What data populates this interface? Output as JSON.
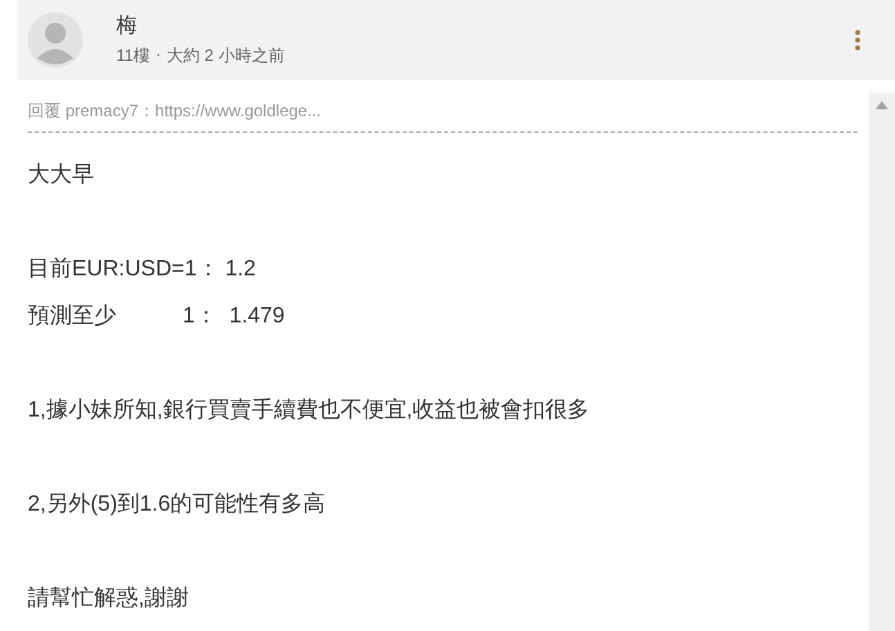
{
  "post": {
    "author": "梅",
    "floor": "11樓",
    "separator": "·",
    "time": "大約 2 小時之前"
  },
  "reply_quote": "回覆 premacy7：https://www.goldlege...",
  "paragraphs": [
    [
      "大大早"
    ],
    [
      "目前EUR:USD=1： 1.2",
      "預測至少　　　1：  1.479"
    ],
    [
      "1,據小妹所知,銀行買賣手續費也不便宜,收益也被會扣很多"
    ],
    [
      "2,另外(5)到1.6的可能性有多高"
    ],
    [
      "請幫忙解惑,謝謝"
    ]
  ]
}
